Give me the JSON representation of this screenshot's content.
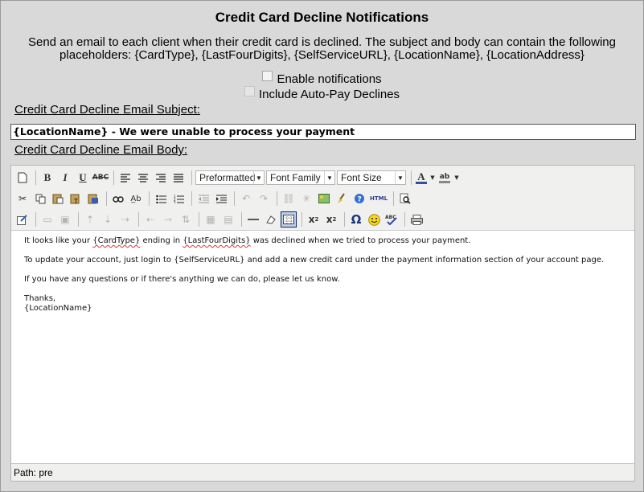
{
  "page": {
    "title": "Credit Card Decline Notifications",
    "description": "Send an email to each client when their credit card is declined. The subject and body can contain the following placeholders: {CardType}, {LastFourDigits}, {SelfServiceURL}, {LocationName}, {LocationAddress}"
  },
  "options": {
    "enable_label": "Enable notifications",
    "autopay_label": "Include Auto-Pay Declines"
  },
  "subject": {
    "label": "Credit Card Decline Email Subject:",
    "value": "{LocationName} - We were unable to process your payment"
  },
  "body": {
    "label": "Credit Card Decline Email Body:",
    "toolbar": {
      "format_select": "Preformatted",
      "font_family_select": "Font Family",
      "font_size_select": "Font Size",
      "html_button": "HTML"
    },
    "content": {
      "line1_a": "It looks like your ",
      "line1_b": "{CardType}",
      "line1_c": " ending in ",
      "line1_d": "{LastFourDigits}",
      "line1_e": " was declined when we tried to process your payment.",
      "line2": "To update your account, just login to {SelfServiceURL} and add a new credit card under the payment information section of your account page.",
      "line3": "If you have any questions or if there's anything we can do, please let us know.",
      "line4": "Thanks,",
      "line5": "{LocationName}"
    },
    "path_label": "Path: pre"
  }
}
